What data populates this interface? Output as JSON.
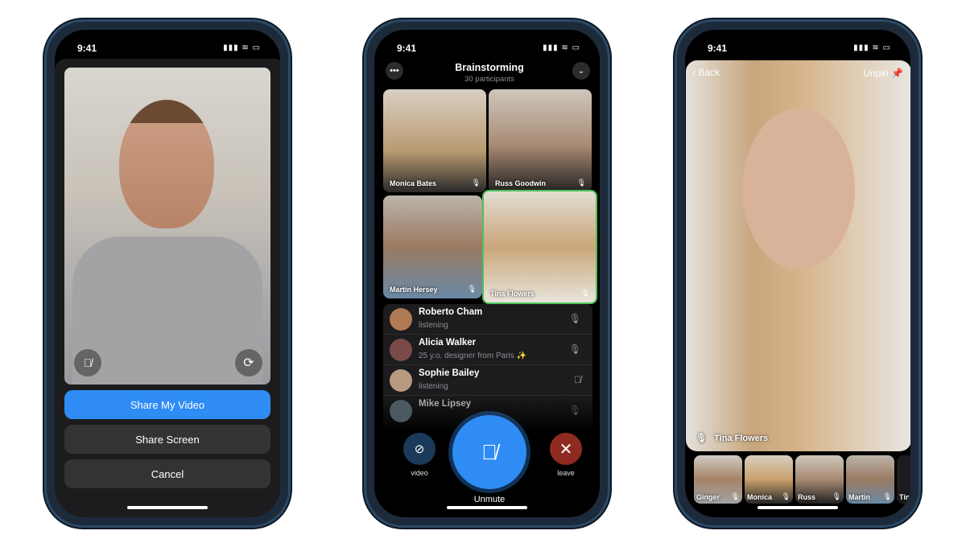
{
  "status": {
    "time": "9:41",
    "signal": "▮▮▮ ≋ ▭"
  },
  "phone1": {
    "buttons": {
      "share_video": "Share My Video",
      "share_screen": "Share Screen",
      "cancel": "Cancel"
    },
    "colors": {
      "primary": "#2f8cf5"
    }
  },
  "phone2": {
    "title": "Brainstorming",
    "subtitle": "30 participants",
    "tiles": [
      {
        "name": "Monica Bates"
      },
      {
        "name": "Russ Goodwin"
      },
      {
        "name": "Martin Hersey"
      },
      {
        "name": "Tina Flowers"
      }
    ],
    "participants": [
      {
        "name": "Roberto Cham",
        "status": "listening"
      },
      {
        "name": "Alicia Walker",
        "status": "25 y.o. designer from Paris ✨"
      },
      {
        "name": "Sophie Bailey",
        "status": "listening"
      },
      {
        "name": "Mike Lipsey",
        "status": ""
      }
    ],
    "controls": {
      "video": "video",
      "unmute": "Unmute",
      "leave": "leave"
    },
    "colors": {
      "speaking": "#4cc25a",
      "unmute": "#2f8cf5",
      "leave": "#8e2a1f",
      "video": "#1b3a5a"
    }
  },
  "phone3": {
    "back": "Back",
    "unpin": "Unpin",
    "speaker": "Tina Flowers",
    "thumbs": [
      {
        "name": "Ginger"
      },
      {
        "name": "Monica"
      },
      {
        "name": "Russ"
      },
      {
        "name": "Martin"
      },
      {
        "name": "Tin"
      }
    ]
  }
}
